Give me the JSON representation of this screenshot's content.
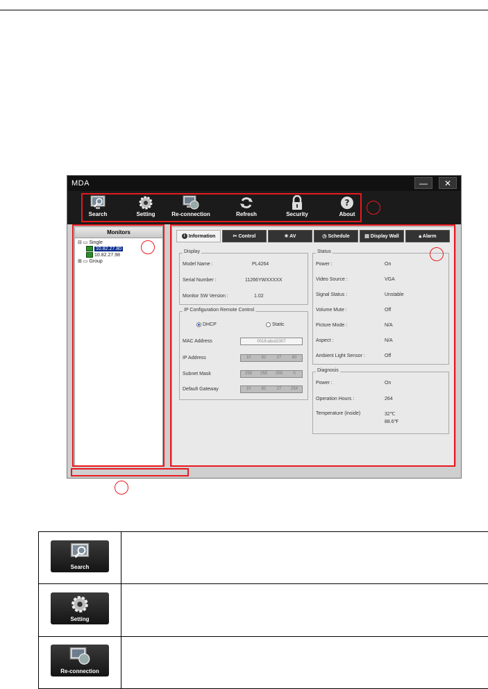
{
  "window": {
    "title": "MDA",
    "minimize": "—",
    "close": "✕"
  },
  "toolbar": {
    "items": [
      {
        "label": "Search",
        "icon": "search-icon"
      },
      {
        "label": "Setting",
        "icon": "gear-icon"
      },
      {
        "label": "Re-connection",
        "icon": "reconnection-icon"
      },
      {
        "label": "Refresh",
        "icon": "refresh-icon"
      },
      {
        "label": "Security",
        "icon": "lock-icon"
      },
      {
        "label": "About",
        "icon": "question-icon"
      }
    ]
  },
  "monitors": {
    "header": "Monitors",
    "single": "Single",
    "ip1": "10.82.27.80",
    "ip2": "10.82.27.98",
    "group": "Group"
  },
  "tabs": [
    "Information",
    "Control",
    "AV",
    "Schedule",
    "Display Wall",
    "Alarm"
  ],
  "display": {
    "title": "Display",
    "model_label": "Model Name :",
    "model_value": "PL4264",
    "serial_label": "Serial Number :",
    "serial_value": "11266YWXXXXX",
    "fw_label": "Monitor SW Version :",
    "fw_value": "1.02"
  },
  "ipconfig": {
    "title": "IP Configuration Remote Control",
    "dhcp": "DHCP",
    "static": "Static",
    "mac_label": "MAC Address",
    "mac_value": "0018:abcd2307",
    "ip_label": "IP Address",
    "ip_values": [
      "10",
      "82",
      "27",
      "80"
    ],
    "mask_label": "Subnet Mask",
    "mask_values": [
      "255",
      "255",
      "255",
      "0"
    ],
    "gw_label": "Default Gateway",
    "gw_values": [
      "10",
      "82",
      "27",
      "254"
    ]
  },
  "status": {
    "title": "Status",
    "rows": [
      {
        "label": "Power :",
        "value": "On"
      },
      {
        "label": "Video Source :",
        "value": "VGA"
      },
      {
        "label": "Signal Status :",
        "value": "Unstable"
      },
      {
        "label": "Volume Mute :",
        "value": "Off"
      },
      {
        "label": "Picture Mode :",
        "value": "N/A"
      },
      {
        "label": "Aspect :",
        "value": "N/A"
      },
      {
        "label": "Ambient Light Sensor :",
        "value": "Off"
      }
    ]
  },
  "diagnosis": {
    "title": "Diagnosis",
    "power_label": "Power :",
    "power_value": "On",
    "hours_label": "Operation Hours :",
    "hours_value": "264",
    "temp_label": "Temperature (inside)",
    "temp_c": "32℃",
    "temp_f": "88.6℉"
  },
  "table": {
    "rows": [
      {
        "label": "Search",
        "icon": "search-icon"
      },
      {
        "label": "Setting",
        "icon": "gear-icon"
      },
      {
        "label": "Re-connection",
        "icon": "reconnection-icon"
      }
    ]
  },
  "colors": {
    "callout": "#e8191f",
    "toolbar_bg": "#1b1b1b",
    "selected": "#0a2c8c"
  }
}
